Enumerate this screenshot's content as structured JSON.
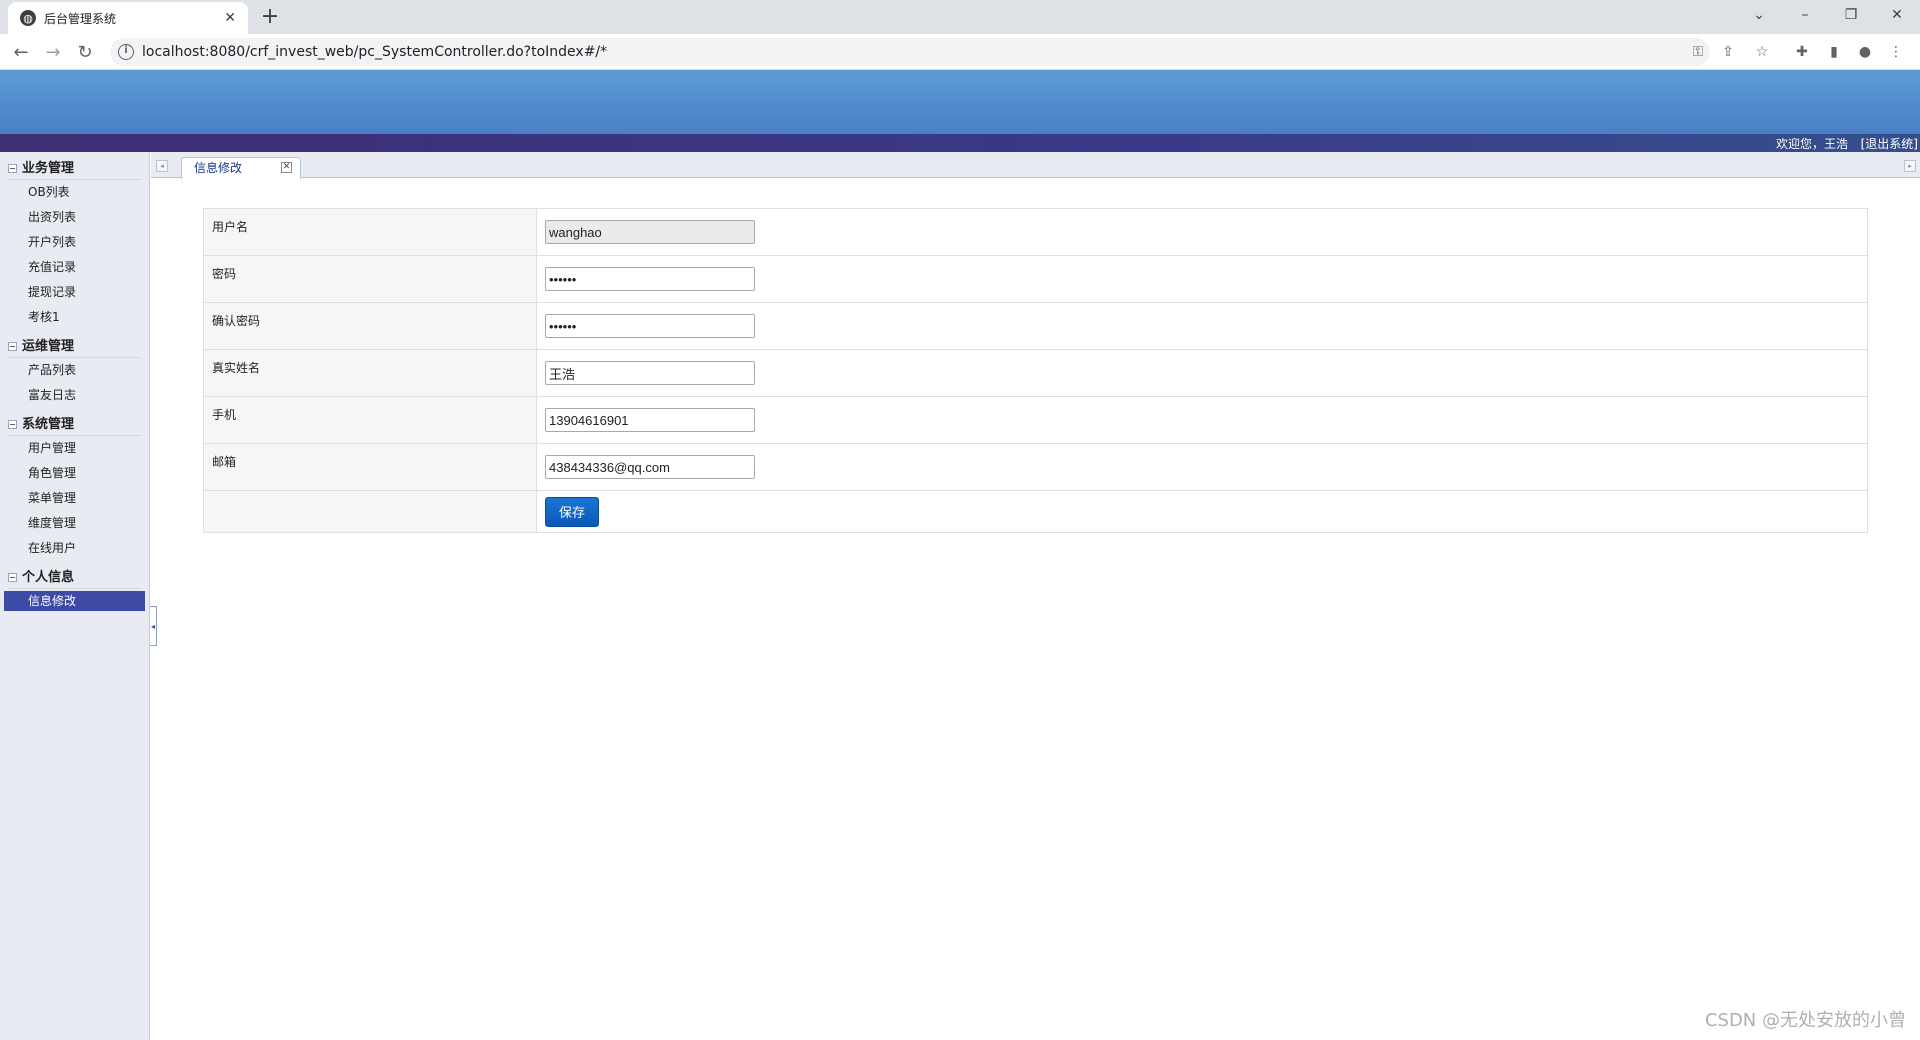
{
  "browser": {
    "tab_title": "后台管理系统",
    "url": "localhost:8080/crf_invest_web/pc_SystemController.do?toIndex#/*"
  },
  "header": {
    "welcome": "欢迎您，王浩",
    "logout": "[退出系统]"
  },
  "sidebar": {
    "groups": [
      {
        "title": "业务管理",
        "items": [
          "OB列表",
          "出资列表",
          "开户列表",
          "充值记录",
          "提现记录",
          "考核1"
        ]
      },
      {
        "title": "运维管理",
        "items": [
          "产品列表",
          "富友日志"
        ]
      },
      {
        "title": "系统管理",
        "items": [
          "用户管理",
          "角色管理",
          "菜单管理",
          "维度管理",
          "在线用户"
        ]
      },
      {
        "title": "个人信息",
        "items": [
          "信息修改"
        ]
      }
    ]
  },
  "content_tab": {
    "label": "信息修改"
  },
  "form": {
    "username_label": "用户名",
    "username_value": "wanghao",
    "password_label": "密码",
    "password_value": "111111",
    "confirm_label": "确认密码",
    "confirm_value": "111111",
    "realname_label": "真实姓名",
    "realname_value": "王浩",
    "phone_label": "手机",
    "phone_value": "13904616901",
    "email_label": "邮箱",
    "email_value": "438434336@qq.com",
    "save_label": "保存"
  },
  "watermark": "CSDN @无处安放的小曾"
}
